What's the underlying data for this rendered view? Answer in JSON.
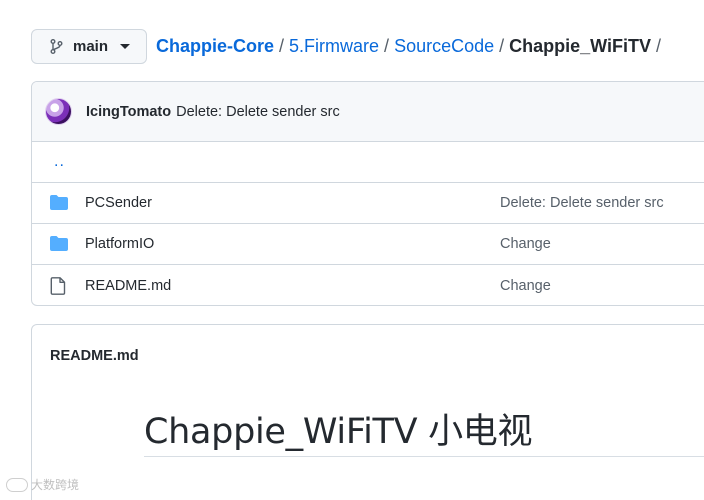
{
  "branch": {
    "name": "main"
  },
  "breadcrumb": {
    "root": "Chappie-Core",
    "segments": [
      "5.Firmware",
      "SourceCode"
    ],
    "current": "Chappie_WiFiTV",
    "separator": "/"
  },
  "latest_commit": {
    "author": "IcingTomato",
    "message": "Delete: Delete sender src"
  },
  "parent_dir": "..",
  "files": [
    {
      "icon": "folder-icon",
      "name": "PCSender",
      "commit": "Delete: Delete sender src"
    },
    {
      "icon": "folder-icon",
      "name": "PlatformIO",
      "commit": "Change"
    },
    {
      "icon": "file-icon",
      "name": "README.md",
      "commit": "Change"
    }
  ],
  "readme": {
    "filename": "README.md",
    "heading": "Chappie_WiFiTV 小电视"
  },
  "watermark": {
    "text": "大数跨境"
  },
  "colors": {
    "link": "#0969da",
    "folder": "#54aeff",
    "border": "#d0d7de",
    "text": "#24292f"
  }
}
